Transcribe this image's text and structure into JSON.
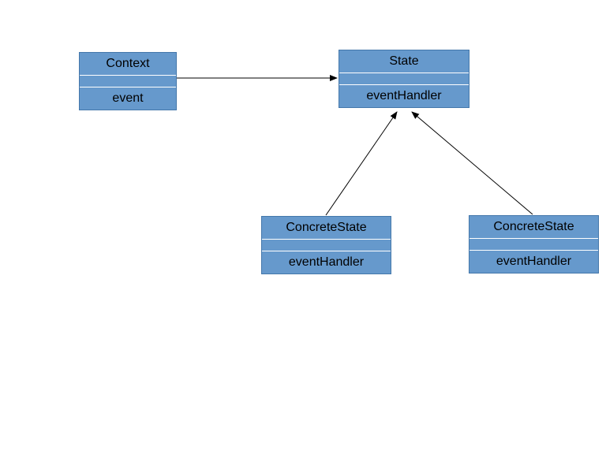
{
  "boxes": {
    "context": {
      "title": "Context",
      "method": "event"
    },
    "state": {
      "title": "State",
      "method": "eventHandler"
    },
    "concrete1": {
      "title": "ConcreteState",
      "method": "eventHandler"
    },
    "concrete2": {
      "title": "ConcreteState",
      "method": "eventHandler"
    }
  }
}
